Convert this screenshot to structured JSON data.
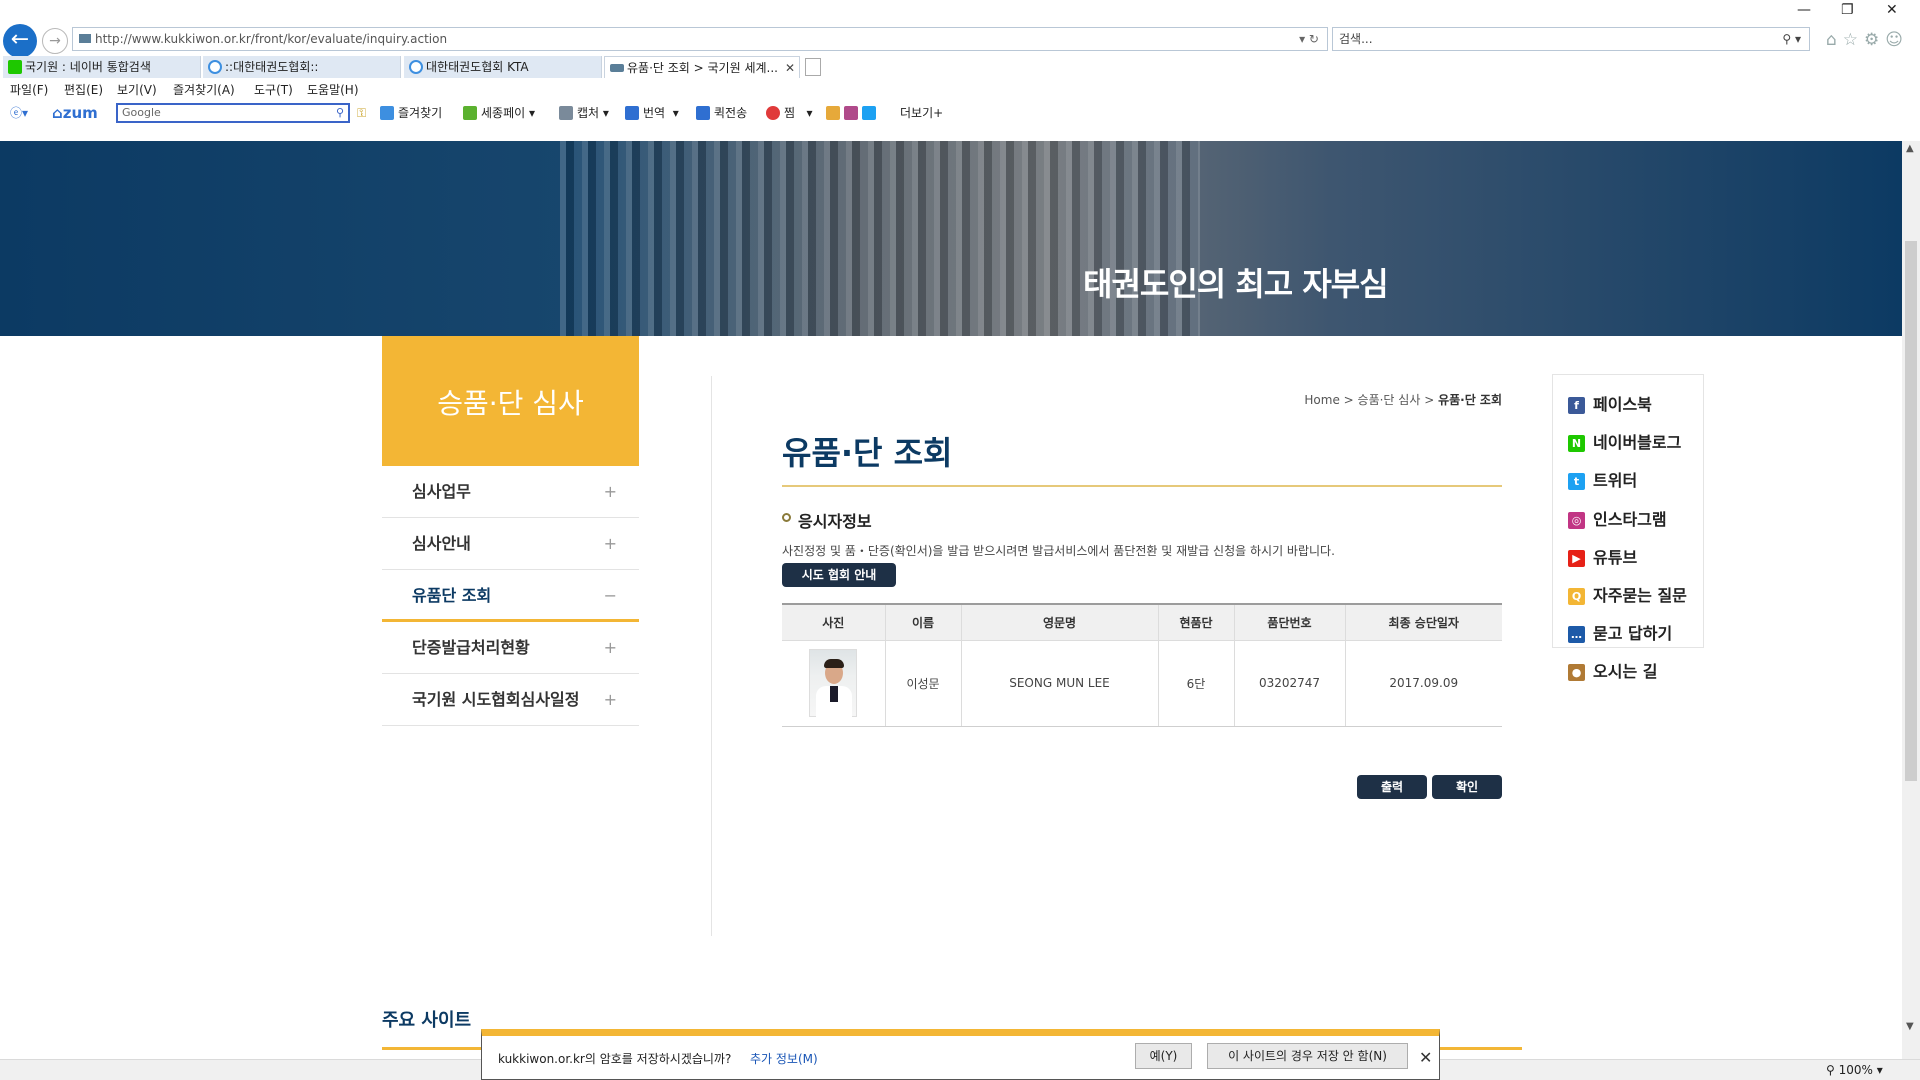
{
  "browser": {
    "url": "http://www.kukkiwon.or.kr/front/kor/evaluate/inquiry.action",
    "search_placeholder": "검색...",
    "tabs": [
      {
        "label": "국기원 : 네이버 통합검색",
        "active": false,
        "icon_color": "#1ec800"
      },
      {
        "label": "::대한태권도협회::",
        "active": false,
        "icon_color": "#3d8fe0"
      },
      {
        "label": "대한태권도협회 KTA",
        "active": false,
        "icon_color": "#3d8fe0"
      },
      {
        "label": "유품·단 조회 > 국기원 세계...",
        "active": true,
        "icon_color": "#5a7e98"
      }
    ],
    "menu": [
      "파일(F)",
      "편집(E)",
      "보기(V)",
      "즐겨찾기(A)",
      "도구(T)",
      "도움말(H)"
    ],
    "toolbar": {
      "zum": "zum",
      "google_placeholder": "Google",
      "favorites": "즐겨찾기",
      "sejong_pay": "세종페이",
      "capture": "캡처",
      "translate": "번역",
      "quick_send": "퀵전송",
      "pick": "찜",
      "more": "더보기+"
    },
    "zoom": "100%"
  },
  "hero": {
    "slogan": "태권도인의 최고 자부심"
  },
  "sidebar": {
    "title": "승품·단 심사",
    "items": [
      {
        "label": "심사업무",
        "sign": "+"
      },
      {
        "label": "심사안내",
        "sign": "+"
      },
      {
        "label": "유품단 조회",
        "sign": "−"
      },
      {
        "label": "단증발급처리현황",
        "sign": "+"
      },
      {
        "label": "국기원 시도협회심사일정",
        "sign": "+"
      }
    ]
  },
  "breadcrumb": {
    "home": "Home",
    "parent": "승품·단 심사",
    "current": "유품·단 조회"
  },
  "main": {
    "title": "유품·단 조회",
    "section_title": "응시자정보",
    "description": "사진정정 및 품・단증(확인서)을 발급 받으시려면 발급서비스에서 품단전환 및 재발급 신청을 하시기 바랍니다.",
    "assoc_button": "시도 협회 안내",
    "table": {
      "headers": [
        "사진",
        "이름",
        "영문명",
        "현품단",
        "품단번호",
        "최종 승단일자"
      ],
      "rows": [
        {
          "name": "이성문",
          "english_name": "SEONG MUN LEE",
          "dan": "6단",
          "number": "03202747",
          "date": "2017.09.09"
        }
      ]
    },
    "print_button": "출력",
    "confirm_button": "확인"
  },
  "quick_links": [
    {
      "label": "페이스북",
      "icon": "facebook-icon",
      "color": "#3b5998",
      "glyph": "f"
    },
    {
      "label": "네이버블로그",
      "icon": "naver-blog-icon",
      "color": "#1ec800",
      "glyph": "N"
    },
    {
      "label": "트위터",
      "icon": "twitter-icon",
      "color": "#1da1f2",
      "glyph": "t"
    },
    {
      "label": "인스타그램",
      "icon": "instagram-icon",
      "color": "#c13584",
      "glyph": "◎"
    },
    {
      "label": "유튜브",
      "icon": "youtube-icon",
      "color": "#e62117",
      "glyph": "▶"
    },
    {
      "label": "자주묻는 질문",
      "icon": "faq-icon",
      "color": "#f3b635",
      "glyph": "Q"
    },
    {
      "label": "묻고 답하기",
      "icon": "qna-icon",
      "color": "#1d5aa8",
      "glyph": "…"
    },
    {
      "label": "오시는 길",
      "icon": "map-pin-icon",
      "color": "#b07a35",
      "glyph": "●"
    }
  ],
  "footer": {
    "major_sites": "주요 사이트"
  },
  "password_bar": {
    "message": "kukkiwon.or.kr의 암호를 저장하시겠습니까?",
    "more_info": "추가 정보(M)",
    "yes": "예(Y)",
    "never": "이 사이트의 경우 저장 안 함(N)"
  }
}
